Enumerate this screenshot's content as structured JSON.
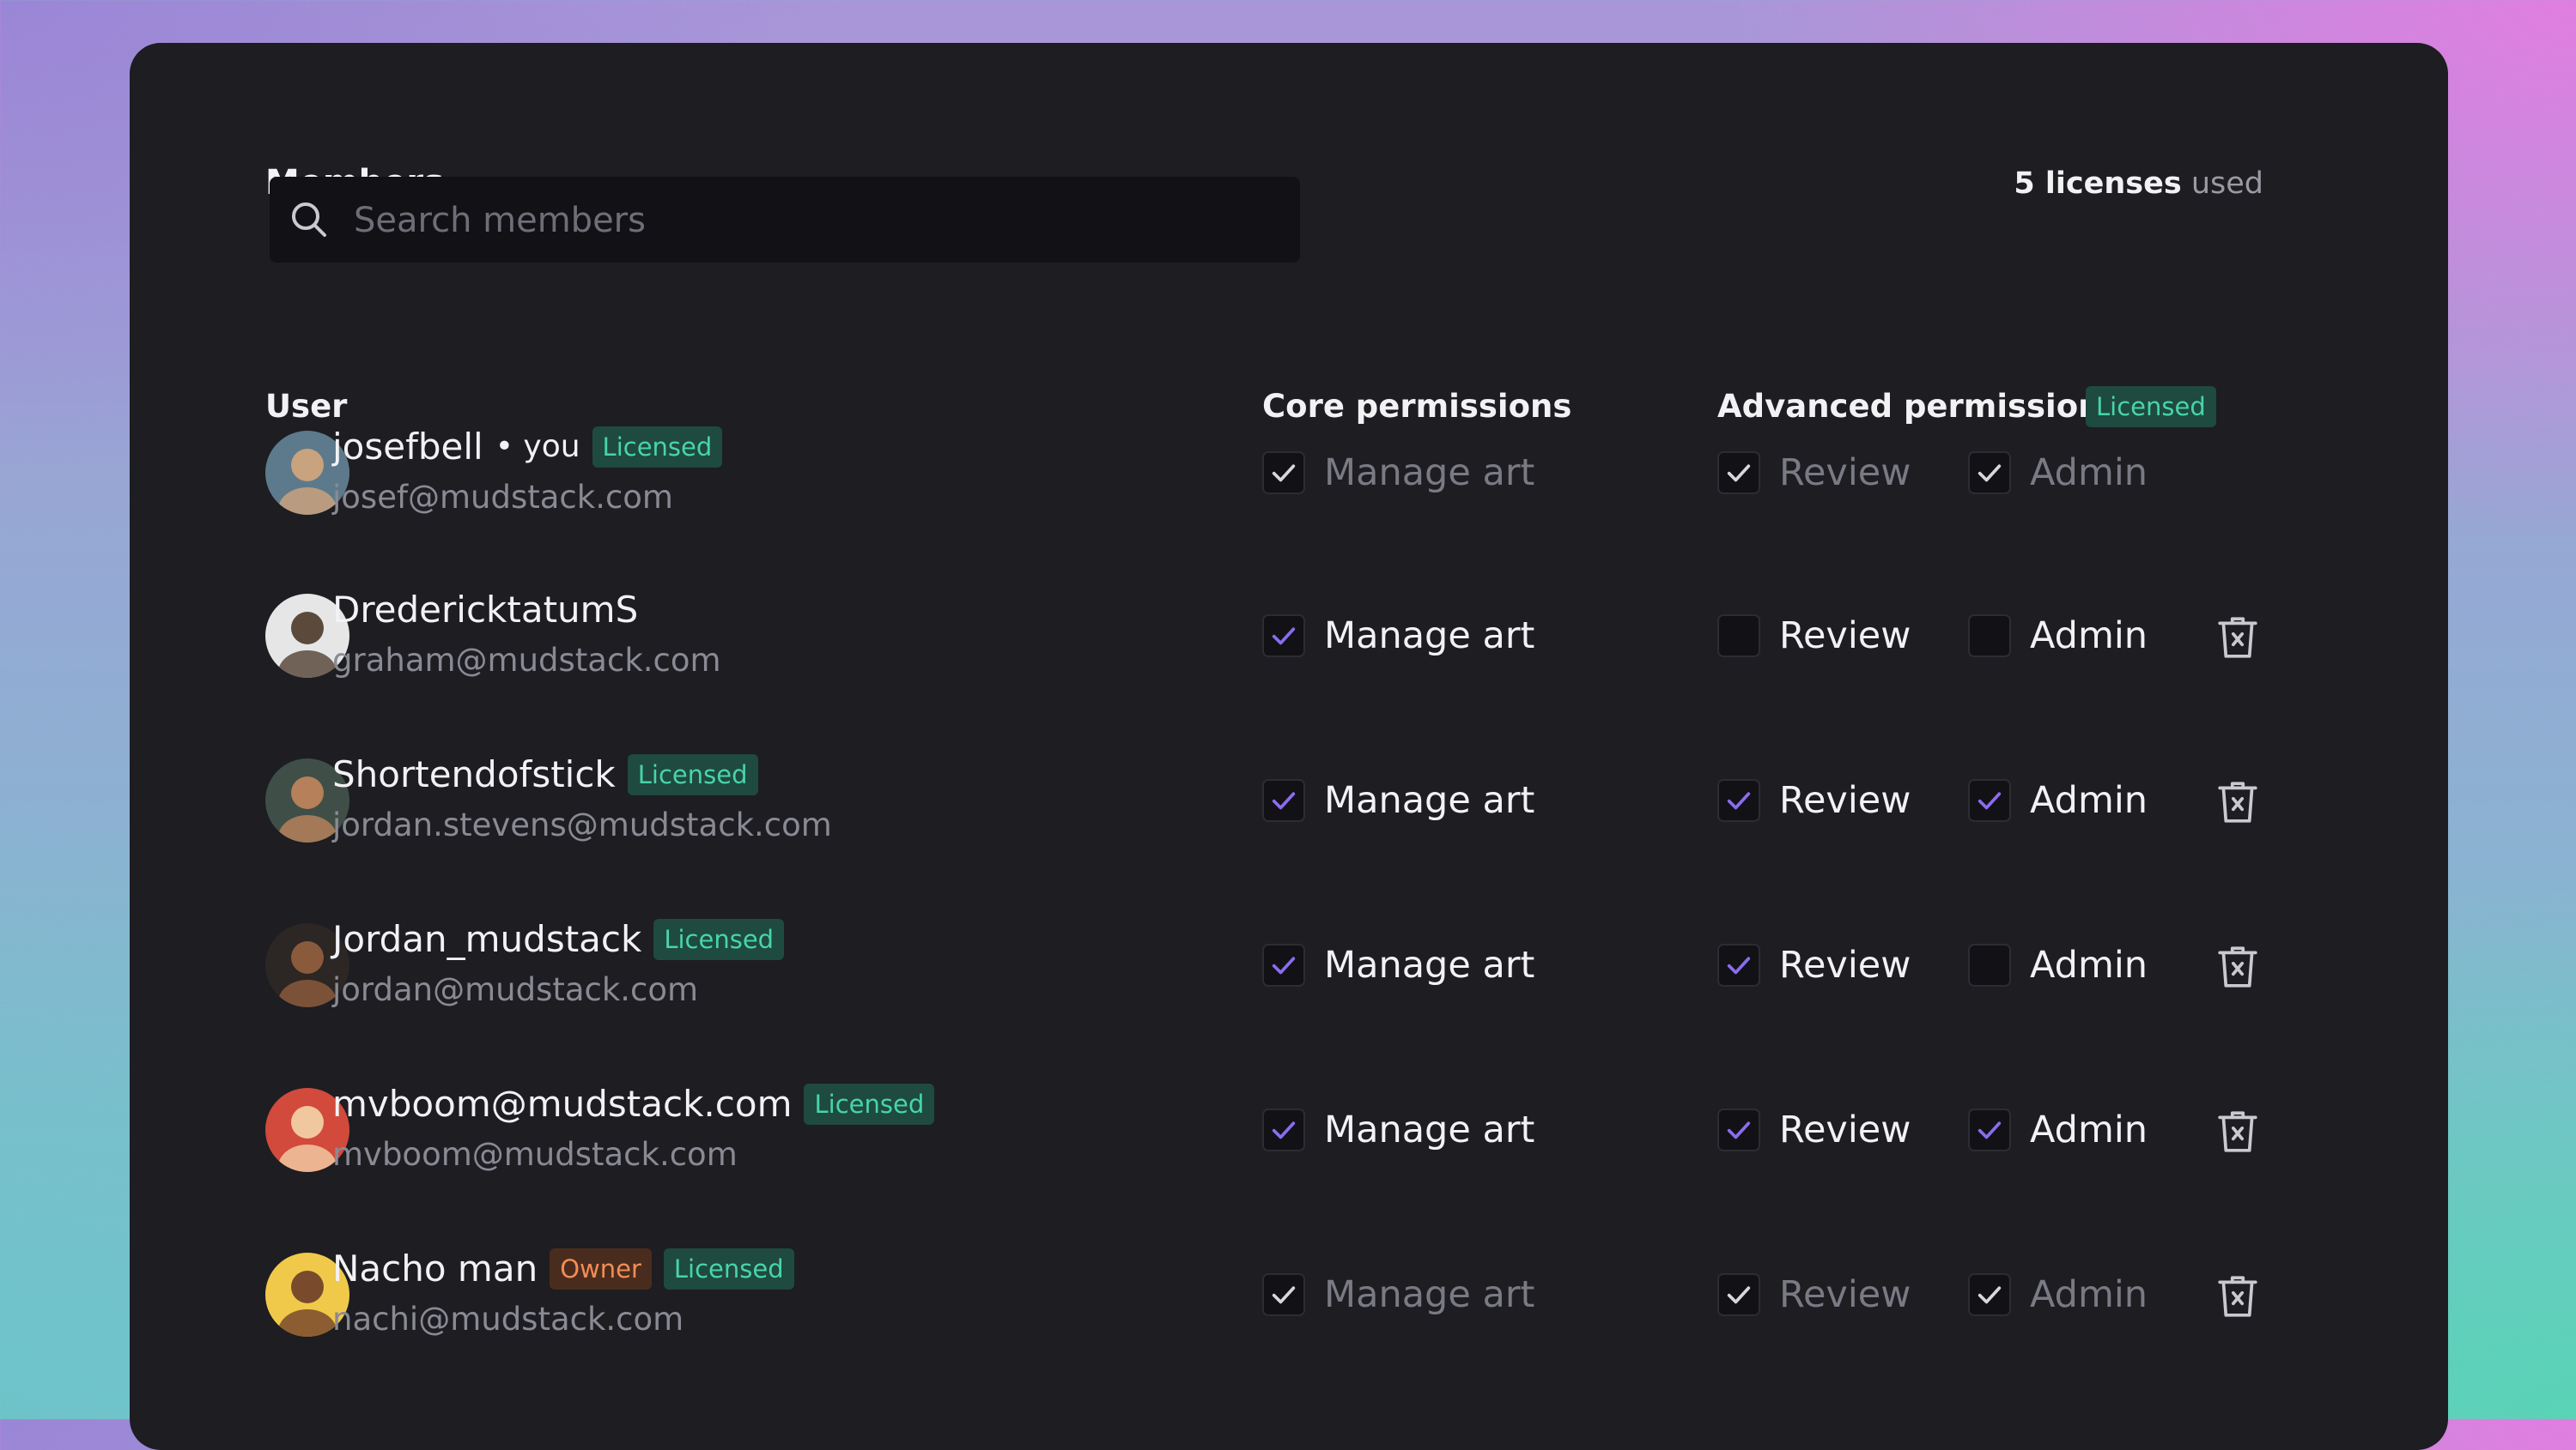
{
  "header": {
    "title": "Members",
    "licenses_count": "5 licenses",
    "licenses_suffix": "used"
  },
  "search": {
    "placeholder": "Search members",
    "value": ""
  },
  "columns": {
    "user": "User",
    "core": "Core permissions",
    "advanced": "Advanced permissions",
    "advanced_badge": "Licensed"
  },
  "badges": {
    "licensed": "Licensed",
    "owner": "Owner",
    "you": "• you"
  },
  "permission_labels": {
    "manage_art": "Manage art",
    "review": "Review",
    "admin": "Admin"
  },
  "colors": {
    "accent_check": "#8b6cf0",
    "dim_check": "#d7d7dc",
    "licensed_badge": "#48d5a6",
    "owner_badge": "#f28d55"
  },
  "users": [
    {
      "name": "josefbell",
      "email": "josef@mudstack.com",
      "is_you": true,
      "owner": false,
      "licensed": true,
      "editable": false,
      "manage_art": true,
      "review": true,
      "admin": true,
      "avatar_icon": "avatar-photo"
    },
    {
      "name": "DredericktatumS",
      "email": "graham@mudstack.com",
      "is_you": false,
      "owner": false,
      "licensed": false,
      "editable": true,
      "manage_art": true,
      "review": false,
      "admin": false,
      "avatar_icon": "avatar-photo"
    },
    {
      "name": "Shortendofstick",
      "email": "jordan.stevens@mudstack.com",
      "is_you": false,
      "owner": false,
      "licensed": true,
      "editable": true,
      "manage_art": true,
      "review": true,
      "admin": true,
      "avatar_icon": "avatar-photo"
    },
    {
      "name": "Jordan_mudstack",
      "email": "jordan@mudstack.com",
      "is_you": false,
      "owner": false,
      "licensed": true,
      "editable": true,
      "manage_art": true,
      "review": true,
      "admin": false,
      "avatar_icon": "avatar-photo"
    },
    {
      "name": "mvboom@mudstack.com",
      "email": "mvboom@mudstack.com",
      "is_you": false,
      "owner": false,
      "licensed": true,
      "editable": true,
      "manage_art": true,
      "review": true,
      "admin": true,
      "avatar_icon": "avatar-photo"
    },
    {
      "name": "Nacho man",
      "email": "nachi@mudstack.com",
      "is_you": false,
      "owner": true,
      "licensed": true,
      "editable": false,
      "manage_art": true,
      "review": true,
      "admin": true,
      "avatar_icon": "avatar-photo"
    }
  ]
}
